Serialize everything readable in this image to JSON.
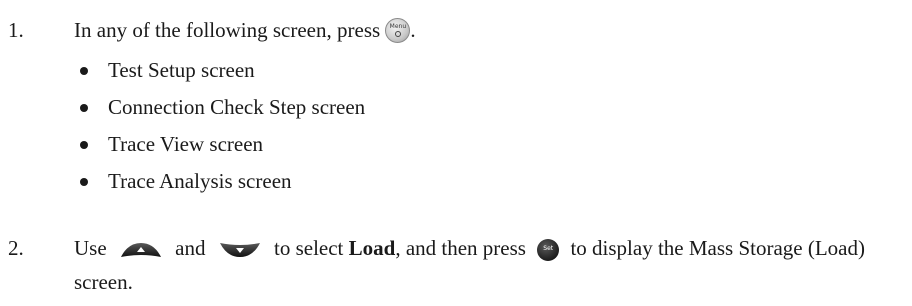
{
  "step1": {
    "number": "1.",
    "text_before_icon": "In any of the following screen, press",
    "text_after_icon": ".",
    "icon": "menu-power-button-icon",
    "icon_label": "Menu",
    "bullets": [
      "Test Setup screen",
      "Connection Check Step screen",
      "Trace View screen",
      "Trace Analysis screen"
    ]
  },
  "step2": {
    "number": "2.",
    "text_use": "Use",
    "up_icon": "up-arrow-button-icon",
    "text_and": "and",
    "down_icon": "down-arrow-button-icon",
    "text_to_select": "to select",
    "bold_word": "Load",
    "text_then_press": ", and then press",
    "set_icon": "set-button-icon",
    "set_label": "Set",
    "text_rest": "to display the Mass Storage (Load) screen."
  }
}
